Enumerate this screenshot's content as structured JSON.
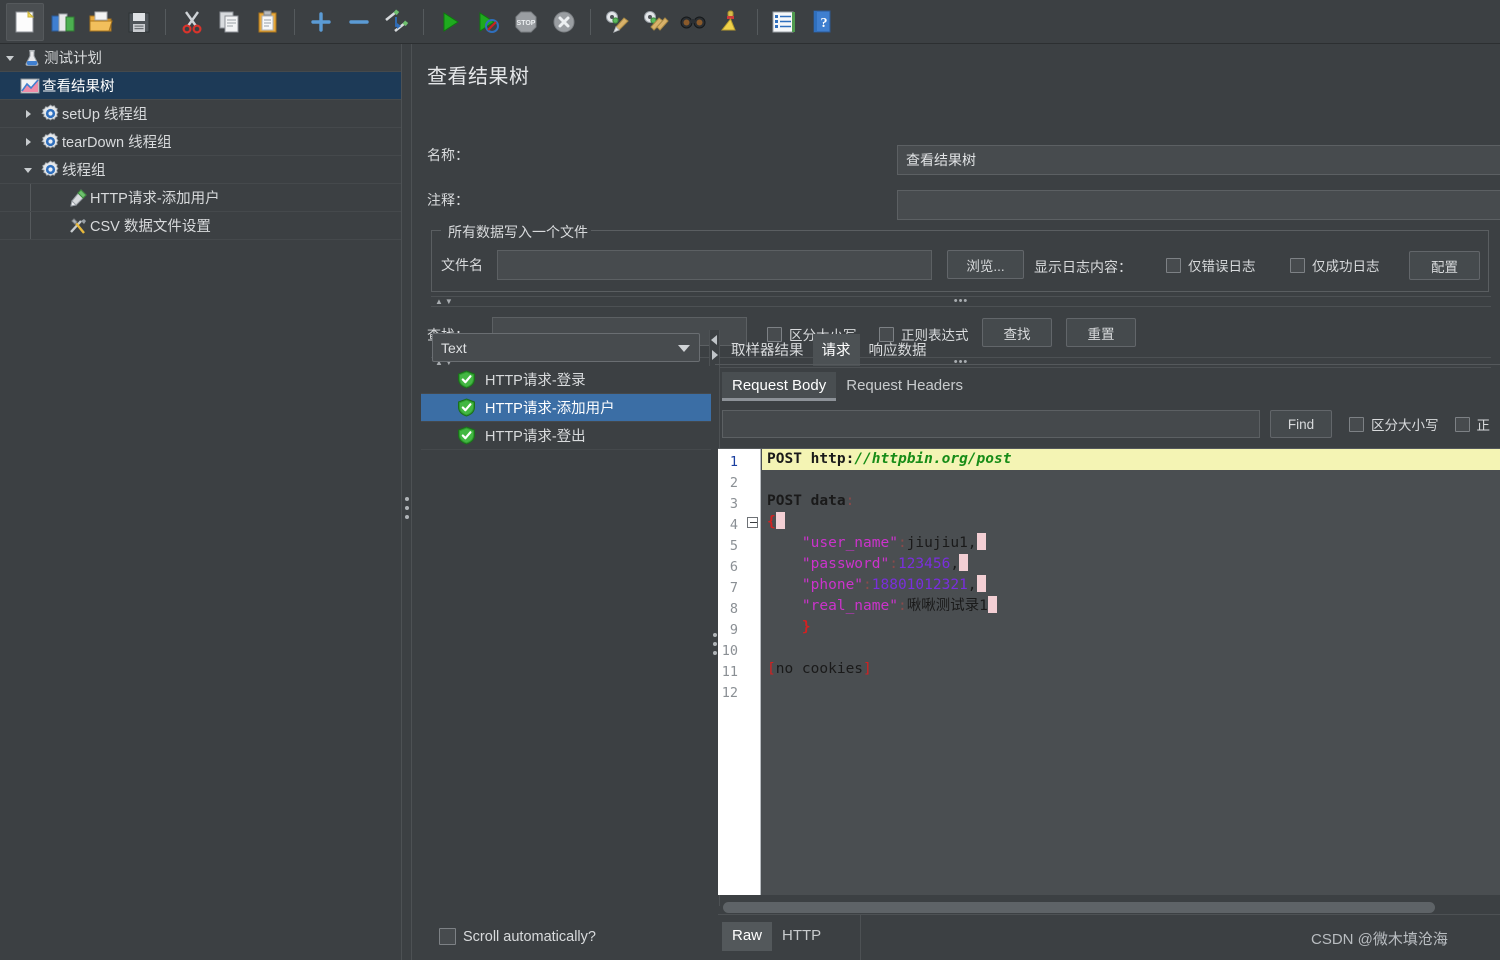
{
  "toolbar": {
    "buttons": [
      {
        "name": "new-icon",
        "title": "新建"
      },
      {
        "name": "templates-icon",
        "title": "模板"
      },
      {
        "name": "open-icon",
        "title": "打开"
      },
      {
        "name": "save-icon",
        "title": "保存"
      },
      {
        "name": "cut-icon",
        "title": "剪切"
      },
      {
        "name": "copy-icon",
        "title": "复制"
      },
      {
        "name": "paste-icon",
        "title": "粘贴"
      },
      {
        "name": "expand-all-icon",
        "title": "展开全部"
      },
      {
        "name": "collapse-all-icon",
        "title": "收起全部"
      },
      {
        "name": "toggle-icon",
        "title": "启用/禁用"
      },
      {
        "name": "start-icon",
        "title": "启动"
      },
      {
        "name": "start-no-pauses-icon",
        "title": "无暂停启动"
      },
      {
        "name": "stop-icon",
        "title": "停止"
      },
      {
        "name": "shutdown-icon",
        "title": "关闭"
      },
      {
        "name": "clear-icon",
        "title": "清除"
      },
      {
        "name": "clear-all-icon",
        "title": "清除全部"
      },
      {
        "name": "search-icon",
        "title": "查找"
      },
      {
        "name": "reset-search-icon",
        "title": "重置查找"
      },
      {
        "name": "function-helper-icon",
        "title": "函数助手"
      },
      {
        "name": "help-icon",
        "title": "帮助"
      }
    ]
  },
  "tree": {
    "items": [
      {
        "label": "测试计划",
        "icon": "test-plan-icon",
        "level": 0,
        "twist": "down",
        "selected": false
      },
      {
        "label": "查看结果树",
        "icon": "view-results-tree-icon",
        "level": 2,
        "twist": "none",
        "selected": true
      },
      {
        "label": "setUp 线程组",
        "icon": "thread-group-icon",
        "level": 1,
        "twist": "right",
        "selected": false
      },
      {
        "label": "tearDown 线程组",
        "icon": "thread-group-icon",
        "level": 1,
        "twist": "right",
        "selected": false
      },
      {
        "label": "线程组",
        "icon": "thread-group-icon",
        "level": 1,
        "twist": "down",
        "selected": false
      },
      {
        "label": "HTTP请求-添加用户",
        "icon": "http-sampler-icon",
        "level": 2,
        "twist": "none",
        "selected": false
      },
      {
        "label": "CSV 数据文件设置",
        "icon": "csv-config-icon",
        "level": 2,
        "twist": "none",
        "selected": false
      }
    ]
  },
  "panel": {
    "title": "查看结果树",
    "name_label": "名称：",
    "name_value": "查看结果树",
    "comment_label": "注释：",
    "comment_value": "",
    "group_label": "所有数据写入一个文件",
    "filename_label": "文件名",
    "filename_value": "",
    "browse_button": "浏览...",
    "log_display_label": "显示日志内容：",
    "errors_only_label": "仅错误日志",
    "errors_only_checked": false,
    "success_only_label": "仅成功日志",
    "success_only_checked": false,
    "configure_button": "配置"
  },
  "search": {
    "label": "查找：",
    "value": "",
    "case_sensitive_label": "区分大小写",
    "case_sensitive_checked": false,
    "regex_label": "正则表达式",
    "regex_checked": false,
    "search_button": "查找",
    "reset_button": "重置"
  },
  "results": {
    "renderer_selected": "Text",
    "renderer_options": [
      "Text"
    ],
    "items": [
      {
        "label": "HTTP请求-登录",
        "status": "success",
        "selected": false
      },
      {
        "label": "HTTP请求-添加用户",
        "status": "success",
        "selected": true
      },
      {
        "label": "HTTP请求-登出",
        "status": "success",
        "selected": false
      }
    ],
    "scroll_auto_label": "Scroll automatically?",
    "scroll_auto_checked": false
  },
  "detail": {
    "tabs": [
      {
        "label": "取样器结果",
        "active": false
      },
      {
        "label": "请求",
        "active": true
      },
      {
        "label": "响应数据",
        "active": false
      }
    ],
    "subtabs": [
      {
        "label": "Request Body",
        "active": true
      },
      {
        "label": "Request Headers",
        "active": false
      }
    ],
    "find": {
      "value": "",
      "find_button": "Find",
      "case_sensitive_label": "区分大小写",
      "case_sensitive_checked": false,
      "regex_label": "正",
      "regex_checked": false
    },
    "bottom_tabs": [
      {
        "label": "Raw",
        "active": true
      },
      {
        "label": "HTTP",
        "active": false
      }
    ],
    "code": {
      "line_numbers": [
        1,
        2,
        3,
        4,
        5,
        6,
        7,
        8,
        9,
        10,
        11,
        12
      ],
      "lines": [
        {
          "n": 1,
          "highlight": true,
          "tokens": [
            {
              "t": "POST ",
              "c": "k-kw"
            },
            {
              "t": "http",
              "c": "k-kw"
            },
            {
              "t": ":",
              "c": "k-col"
            },
            {
              "t": "//httpbin.org/post",
              "c": "k-url"
            }
          ]
        },
        {
          "n": 2,
          "highlight": false,
          "tokens": []
        },
        {
          "n": 3,
          "highlight": false,
          "tokens": [
            {
              "t": "POST data",
              "c": "k-kw"
            },
            {
              "t": ":",
              "c": "k-sep"
            }
          ]
        },
        {
          "n": 4,
          "highlight": false,
          "fold": true,
          "tokens": [
            {
              "t": "{",
              "c": "k-brace"
            },
            {
              "t": " ",
              "c": "sel-mark"
            }
          ]
        },
        {
          "n": 5,
          "highlight": false,
          "tokens": [
            {
              "t": "    \"user_name\"",
              "c": "k-str"
            },
            {
              "t": ":",
              "c": "k-sep"
            },
            {
              "t": "jiujiu1,",
              "c": "k-val"
            },
            {
              "t": " ",
              "c": "sel-mark"
            }
          ]
        },
        {
          "n": 6,
          "highlight": false,
          "tokens": [
            {
              "t": "    \"password\"",
              "c": "k-str"
            },
            {
              "t": ":",
              "c": "k-sep"
            },
            {
              "t": "123456",
              "c": "k-num"
            },
            {
              "t": ",",
              "c": "k-val"
            },
            {
              "t": " ",
              "c": "sel-mark"
            }
          ]
        },
        {
          "n": 7,
          "highlight": false,
          "tokens": [
            {
              "t": "    \"phone\"",
              "c": "k-str"
            },
            {
              "t": ":",
              "c": "k-sep"
            },
            {
              "t": "18801012321",
              "c": "k-num"
            },
            {
              "t": ",",
              "c": "k-val"
            },
            {
              "t": " ",
              "c": "sel-mark"
            }
          ]
        },
        {
          "n": 8,
          "highlight": false,
          "tokens": [
            {
              "t": "    \"real_name\"",
              "c": "k-str"
            },
            {
              "t": ":",
              "c": "k-sep"
            },
            {
              "t": "啾啾测试录1",
              "c": "k-val"
            },
            {
              "t": " ",
              "c": "sel-mark"
            }
          ]
        },
        {
          "n": 9,
          "highlight": false,
          "tokens": [
            {
              "t": "    }",
              "c": "k-brace"
            }
          ]
        },
        {
          "n": 10,
          "highlight": false,
          "tokens": []
        },
        {
          "n": 11,
          "highlight": false,
          "tokens": [
            {
              "t": "[",
              "c": "k-cook"
            },
            {
              "t": "no cookies",
              "c": "k-cook2"
            },
            {
              "t": "]",
              "c": "k-cook"
            }
          ]
        },
        {
          "n": 12,
          "highlight": false,
          "tokens": []
        }
      ],
      "raw_text": "POST http://httpbin.org/post\n\nPOST data:\n{\n    \"user_name\":jiujiu1,\n    \"password\":123456,\n    \"phone\":18801012321,\n    \"real_name\":啾啾测试录1\n    }\n\n[no cookies]\n"
    }
  },
  "watermark": "CSDN @微木填沧海",
  "colors": {
    "background": "#3c4043",
    "selection_blue": "#3b6ea5",
    "tree_selection": "#1d3a57",
    "code_highlight": "#f4f4b4",
    "string_magenta": "#cc33cc",
    "number_purple": "#7a2ede",
    "brace_red": "#d42020",
    "url_green": "#178c17"
  }
}
